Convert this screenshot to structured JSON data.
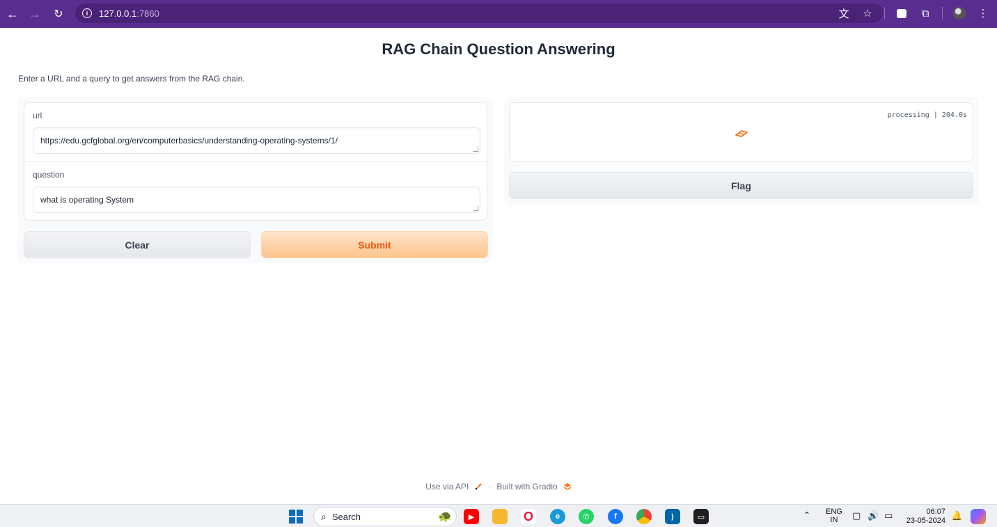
{
  "browser": {
    "url_host": "127.0.0.1",
    "url_port": ":7860",
    "back_icon": "arrow-left-icon",
    "forward_icon": "arrow-right-icon",
    "reload_icon": "reload-icon"
  },
  "page": {
    "title": "RAG Chain Question Answering",
    "description": "Enter a URL and a query to get answers from the RAG chain."
  },
  "inputs": {
    "url_label": "url",
    "url_value": "https://edu.gcfglobal.org/en/computerbasics/understanding-operating-systems/1/",
    "question_label": "question",
    "question_value": "what is operating System"
  },
  "buttons": {
    "clear_label": "Clear",
    "submit_label": "Submit",
    "flag_label": "Flag"
  },
  "output": {
    "status": "processing | 204.0s"
  },
  "footer": {
    "api_label": "Use via API",
    "separator": "·",
    "built_label": "Built with Gradio"
  },
  "taskbar": {
    "search_label": "Search",
    "lang_top": "ENG",
    "lang_bottom": "IN",
    "time": "06:07",
    "date": "23-05-2024"
  },
  "colors": {
    "browser_bar": "#5a2d91",
    "accent_orange": "#ea580c",
    "submit_bg": "#fdc58b"
  }
}
